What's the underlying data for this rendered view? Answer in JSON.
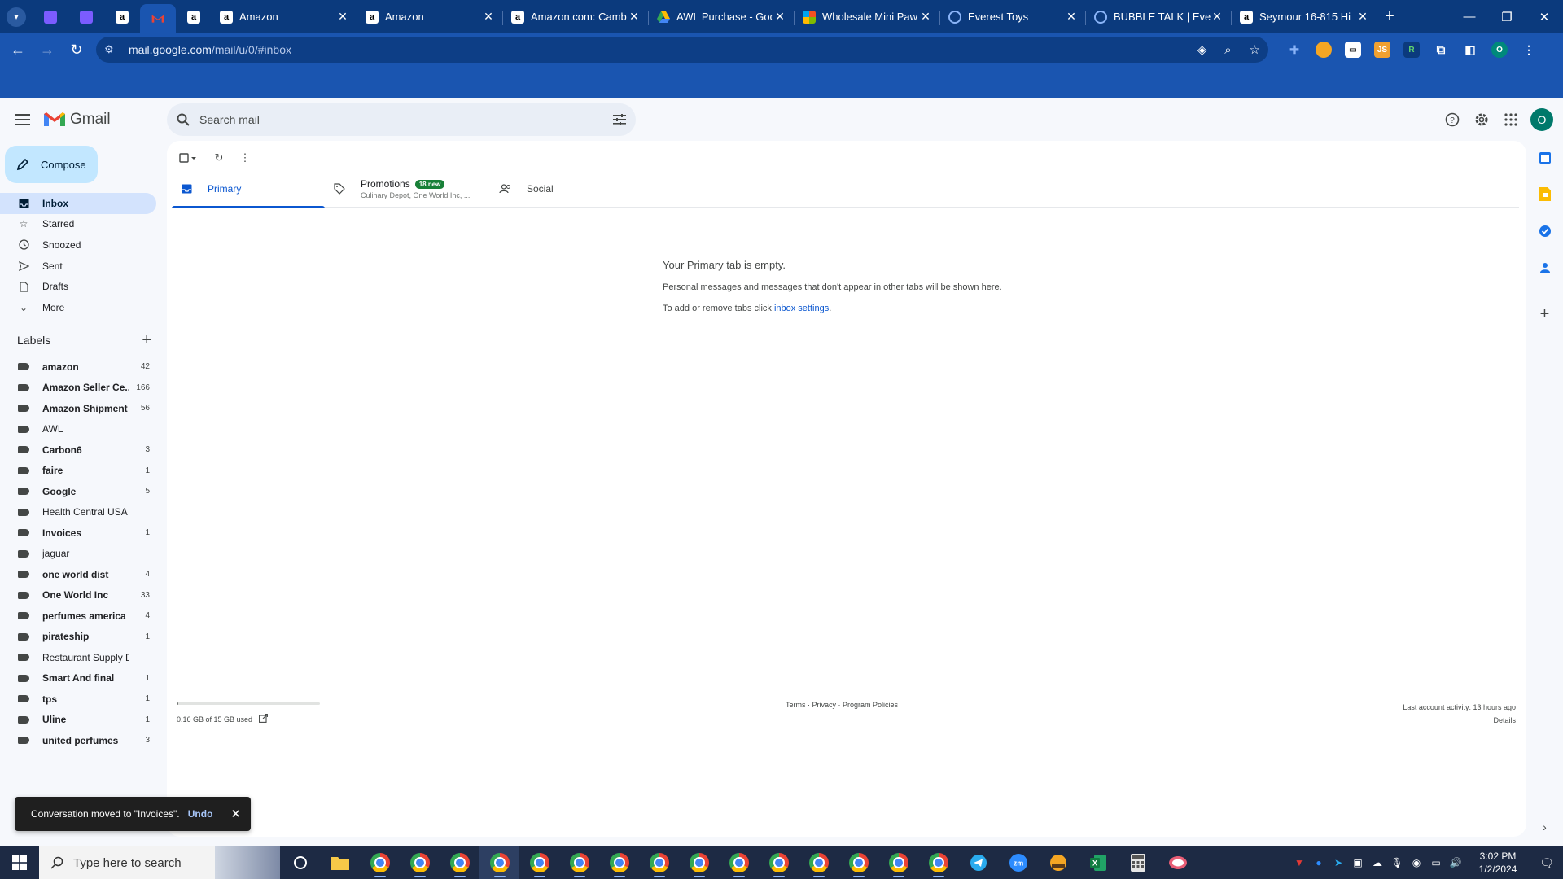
{
  "browser": {
    "tabs": [
      {
        "title": "Amazon",
        "favicon": "amazon-icon"
      },
      {
        "title": "Amazon",
        "favicon": "amazon-icon"
      },
      {
        "title": "Amazon.com: Camb",
        "favicon": "amazon-icon"
      },
      {
        "title": "AWL Purchase - Goo",
        "favicon": "google-drive-icon"
      },
      {
        "title": "Wholesale Mini Paw",
        "favicon": "microsoft-icon"
      },
      {
        "title": "Everest Toys",
        "favicon": "globe-icon"
      },
      {
        "title": "BUBBLE TALK | Evere",
        "favicon": "globe-icon"
      },
      {
        "title": "Seymour 16-815 Hi",
        "favicon": "amazon-icon"
      }
    ],
    "url_host": "mail.google.com",
    "url_path": "/mail/u/0/#inbox",
    "profile_initial": "O",
    "accent": "#1a55b0"
  },
  "gmail": {
    "logo_text": "Gmail",
    "search_placeholder": "Search mail",
    "avatar_initial": "O",
    "compose_label": "Compose",
    "nav": [
      {
        "label": "Inbox",
        "icon": "inbox-icon",
        "active": true
      },
      {
        "label": "Starred",
        "icon": "star-icon"
      },
      {
        "label": "Snoozed",
        "icon": "clock-icon"
      },
      {
        "label": "Sent",
        "icon": "send-icon"
      },
      {
        "label": "Drafts",
        "icon": "draft-icon"
      },
      {
        "label": "More",
        "icon": "chevron-down-icon"
      }
    ],
    "labels_heading": "Labels",
    "labels": [
      {
        "name": "amazon",
        "count": "42",
        "bold": true
      },
      {
        "name": "Amazon Seller Ce...",
        "count": "166",
        "bold": true
      },
      {
        "name": "Amazon Shipment",
        "count": "56",
        "bold": true
      },
      {
        "name": "AWL",
        "count": "",
        "bold": false
      },
      {
        "name": "Carbon6",
        "count": "3",
        "bold": true
      },
      {
        "name": "faire",
        "count": "1",
        "bold": true
      },
      {
        "name": "Google",
        "count": "5",
        "bold": true
      },
      {
        "name": "Health Central USA",
        "count": "",
        "bold": false
      },
      {
        "name": "Invoices",
        "count": "1",
        "bold": true
      },
      {
        "name": "jaguar",
        "count": "",
        "bold": false
      },
      {
        "name": "one world dist",
        "count": "4",
        "bold": true
      },
      {
        "name": "One World Inc",
        "count": "33",
        "bold": true
      },
      {
        "name": "perfumes america",
        "count": "4",
        "bold": true
      },
      {
        "name": "pirateship",
        "count": "1",
        "bold": true
      },
      {
        "name": "Restaurant Supply D",
        "count": "",
        "bold": false
      },
      {
        "name": "Smart And final",
        "count": "1",
        "bold": true
      },
      {
        "name": "tps",
        "count": "1",
        "bold": true
      },
      {
        "name": "Uline",
        "count": "1",
        "bold": true
      },
      {
        "name": "united perfumes",
        "count": "3",
        "bold": true
      }
    ],
    "tabs": {
      "primary": "Primary",
      "promotions": "Promotions",
      "promotions_badge": "18 new",
      "promotions_sub": "Culinary Depot, One World Inc, ...",
      "social": "Social"
    },
    "empty": {
      "title": "Your Primary tab is empty.",
      "line1": "Personal messages and messages that don't appear in other tabs will be shown here.",
      "line2_prefix": "To add or remove tabs click ",
      "line2_link": "inbox settings",
      "line2_suffix": "."
    },
    "footer": {
      "storage_text": "0.16 GB of 15 GB used",
      "storage_fraction": 0.011,
      "terms": "Terms · Privacy · Program Policies",
      "activity": "Last account activity: 13 hours ago",
      "details": "Details"
    },
    "snackbar": {
      "message": "Conversation moved to \"Invoices\".",
      "undo": "Undo"
    }
  },
  "taskbar": {
    "search_placeholder": "Type here to search",
    "time": "3:02 PM",
    "date": "1/2/2024"
  }
}
